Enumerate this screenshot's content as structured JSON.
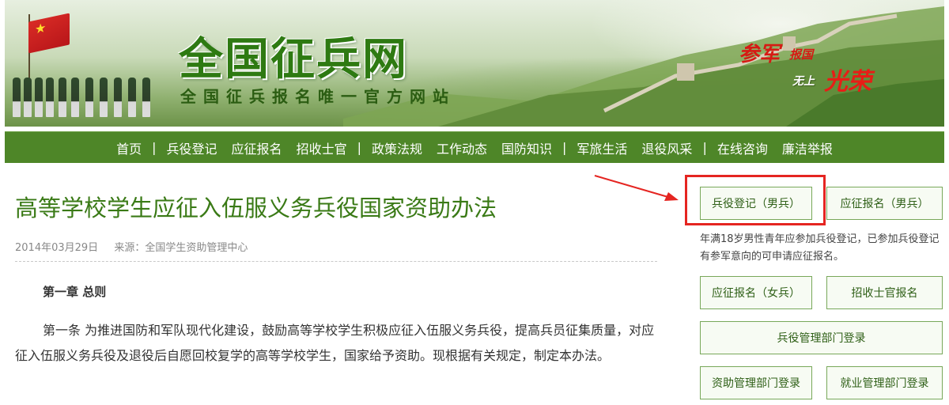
{
  "header": {
    "site_title": "全国征兵网",
    "site_subtitle": "全国征兵报名唯一官方网站",
    "slogan": [
      "参军",
      "报国",
      "无上",
      "光荣"
    ]
  },
  "nav": {
    "items": [
      "首页",
      "兵役登记",
      "应征报名",
      "招收士官",
      "政策法规",
      "工作动态",
      "国防知识",
      "军旅生活",
      "退役风采",
      "在线咨询",
      "廉洁举报"
    ],
    "separator": "|"
  },
  "article": {
    "title": "高等学校学生应征入伍服义务兵役国家资助办法",
    "date": "2014年03月29日",
    "source": "来源：全国学生资助管理中心",
    "chapter": "第一章 总则",
    "paragraph_1": "第一条 为推进国防和军队现代化建设，鼓励高等学校学生积极应征入伍服义务兵役，提高兵员征集质量，对应征入伍服义务兵役及退役后自愿回校复学的高等学校学生，国家给予资助。现根据有关规定，制定本办法。"
  },
  "sidebar": {
    "btn_register_male": "兵役登记（男兵）",
    "btn_apply_male": "应征报名（男兵）",
    "note": "年满18岁男性青年应参加兵役登记，已参加兵役登记有参军意向的可申请应征报名。",
    "btn_apply_female": "应征报名（女兵）",
    "btn_nco": "招收士官报名",
    "btn_admin_login": "兵役管理部门登录",
    "btn_aid_login": "资助管理部门登录",
    "btn_employment_login": "就业管理部门登录"
  },
  "colors": {
    "nav_bg": "#4e8628",
    "title_green": "#3a7a16",
    "highlight_red": "#e52521"
  }
}
